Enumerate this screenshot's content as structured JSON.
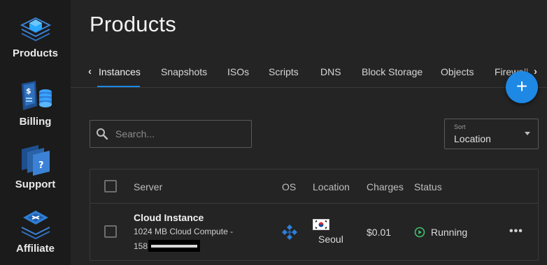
{
  "sidebar": {
    "items": [
      {
        "label": "Products",
        "icon": "products-icon"
      },
      {
        "label": "Billing",
        "icon": "billing-icon"
      },
      {
        "label": "Support",
        "icon": "support-icon"
      },
      {
        "label": "Affiliate",
        "icon": "affiliate-icon"
      }
    ]
  },
  "page": {
    "title": "Products"
  },
  "tabs": [
    {
      "label": "Instances",
      "active": true
    },
    {
      "label": "Snapshots"
    },
    {
      "label": "ISOs"
    },
    {
      "label": "Scripts"
    },
    {
      "label": "DNS"
    },
    {
      "label": "Block Storage"
    },
    {
      "label": "Objects"
    },
    {
      "label": "Firewall"
    }
  ],
  "fab": {
    "label": "+"
  },
  "search": {
    "placeholder": "Search...",
    "value": ""
  },
  "sort": {
    "label": "Sort",
    "value": "Location"
  },
  "table": {
    "columns": [
      "Server",
      "OS",
      "Location",
      "Charges",
      "Status"
    ],
    "rows": [
      {
        "name": "Cloud Instance",
        "plan": "1024 MB Cloud Compute -",
        "ip_prefix": "158",
        "os_icon": "os-logo-icon",
        "location_flag": "south-korea-flag-icon",
        "location": "Seoul",
        "charges": "$0.01",
        "status": "Running",
        "status_color": "#3ec26a"
      }
    ]
  },
  "colors": {
    "accent": "#1e88e5",
    "background": "#242424",
    "sidebar": "#1b1b1b",
    "running": "#3ec26a"
  }
}
